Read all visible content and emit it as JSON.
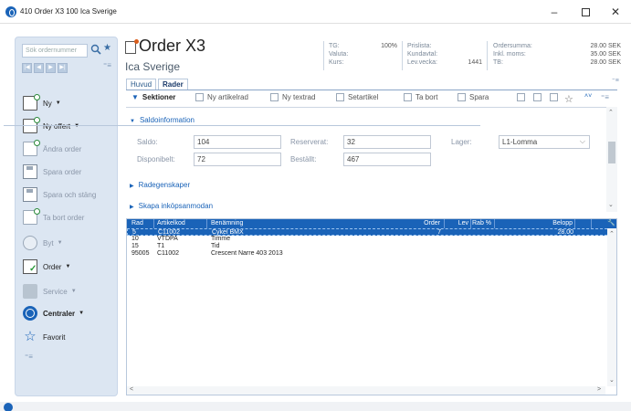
{
  "window": {
    "title": "410 Order X3 100 Ica Sverige"
  },
  "leftnav": {
    "search_placeholder": "Sök ordernummer",
    "items": [
      {
        "label": "Ny"
      },
      {
        "label": "Ny offert"
      },
      {
        "label": "Ändra order"
      },
      {
        "label": "Spara order"
      },
      {
        "label": "Spara och stäng"
      },
      {
        "label": "Ta bort order"
      },
      {
        "label": "Byt"
      },
      {
        "label": "Order"
      },
      {
        "label": "Service"
      },
      {
        "label": "Centraler"
      },
      {
        "label": "Favorit"
      }
    ]
  },
  "header": {
    "title": "Order X3",
    "customer": "Ica Sverige",
    "tg_label": "TG:",
    "tg_value": "100%",
    "valuta_label": "Valuta:",
    "kurs_label": "Kurs:",
    "prislista_label": "Prislista:",
    "kundavtal_label": "Kundavtal:",
    "levvecka_label": "Lev.vecka:",
    "levvecka_value": "1441",
    "ordersumma_label": "Ordersumma:",
    "ordersumma_value": "28.00 SEK",
    "inklmoms_label": "Inkl. moms:",
    "inklmoms_value": "35.00 SEK",
    "tb_label": "TB:",
    "tb_value": "28.00 SEK"
  },
  "tabs": [
    {
      "label": "Huvud"
    },
    {
      "label": "Rader"
    }
  ],
  "toolbar": {
    "sektioner": "Sektioner",
    "ny_artikelrad": "Ny artikelrad",
    "ny_textrad": "Ny textrad",
    "setartikel": "Setartikel",
    "ta_bort": "Ta bort",
    "spara": "Spara"
  },
  "saldo": {
    "section_title": "Saldoinformation",
    "saldo_label": "Saldo:",
    "saldo_value": "104",
    "disponibelt_label": "Disponibelt:",
    "disponibelt_value": "72",
    "reserverat_label": "Reserverat:",
    "reserverat_value": "32",
    "bestallt_label": "Beställt:",
    "bestallt_value": "467",
    "lager_label": "Lager:",
    "lager_value": "L1-Lomma"
  },
  "sections": {
    "radegenskaper": "Radegenskaper",
    "inkopsanmodan": "Skapa inköpsanmodan"
  },
  "grid": {
    "headers": {
      "rad": "Rad",
      "artikelkod": "Artikelkod",
      "benamning": "Benämning",
      "order": "Order",
      "lev": "Lev",
      "rab": "Rab %",
      "belopp": "Belopp"
    },
    "rows": [
      {
        "rad": "5",
        "artikelkod": "C11002",
        "benamning": "Cykel BMX",
        "order": "7",
        "belopp": "28.00"
      },
      {
        "rad": "10",
        "artikelkod": "VTDPA",
        "benamning": "Timme",
        "order": "",
        "belopp": ""
      },
      {
        "rad": "15",
        "artikelkod": "T1",
        "benamning": "Tid",
        "order": "",
        "belopp": ""
      },
      {
        "rad": "95005",
        "artikelkod": "C11002",
        "benamning": "Crescent Narre 403 2013",
        "order": "",
        "belopp": ""
      }
    ]
  }
}
